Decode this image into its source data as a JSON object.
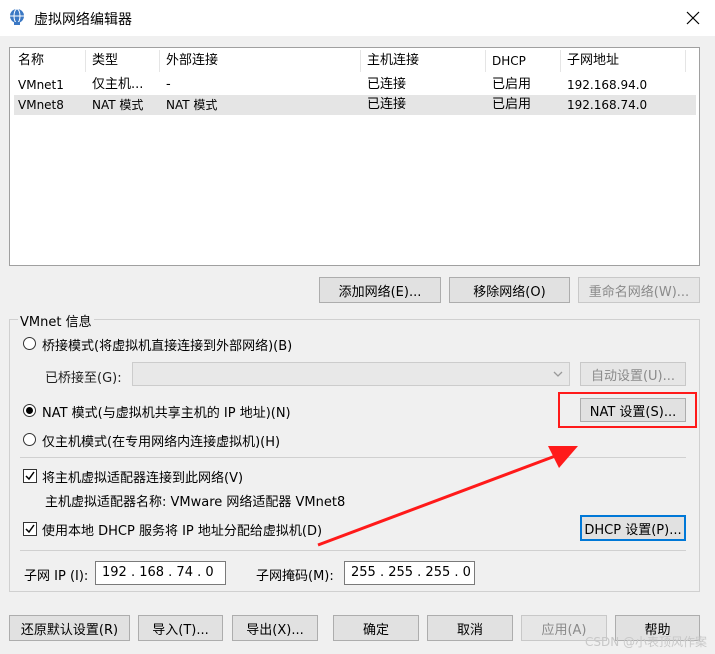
{
  "window": {
    "title": "虚拟网络编辑器",
    "close_label": "关闭"
  },
  "list": {
    "headers": [
      "名称",
      "类型",
      "外部连接",
      "主机连接",
      "DHCP",
      "子网地址"
    ],
    "rows": [
      {
        "name": "VMnet1",
        "type": "仅主机...",
        "external": "-",
        "host": "已连接",
        "dhcp": "已启用",
        "subnet": "192.168.94.0"
      },
      {
        "name": "VMnet8",
        "type": "NAT 模式",
        "external": "NAT 模式",
        "host": "已连接",
        "dhcp": "已启用",
        "subnet": "192.168.74.0"
      }
    ]
  },
  "list_buttons": {
    "add": "添加网络(E)...",
    "remove": "移除网络(O)",
    "rename": "重命名网络(W)..."
  },
  "vmnet_info": {
    "legend": "VMnet 信息",
    "bridged": "桥接模式(将虚拟机直接连接到外部网络)(B)",
    "bridged_to_label": "已桥接至(G):",
    "bridged_to_value": "",
    "auto_settings": "自动设置(U)...",
    "nat": "NAT 模式(与虚拟机共享主机的 IP 地址)(N)",
    "nat_settings": "NAT 设置(S)...",
    "host_only": "仅主机模式(在专用网络内连接虚拟机)(H)",
    "connect_adapter": "将主机虚拟适配器连接到此网络(V)",
    "adapter_name": "主机虚拟适配器名称: VMware 网络适配器 VMnet8",
    "use_dhcp": "使用本地 DHCP 服务将 IP 地址分配给虚拟机(D)",
    "dhcp_settings": "DHCP 设置(P)...",
    "subnet_ip_label": "子网 IP (I):",
    "subnet_ip": "192 . 168 . 74 . 0",
    "subnet_mask_label": "子网掩码(M):",
    "subnet_mask": "255 . 255 . 255 . 0",
    "selected_mode": "nat"
  },
  "footer": {
    "restore": "还原默认设置(R)",
    "import": "导入(T)...",
    "export": "导出(X)...",
    "ok": "确定",
    "cancel": "取消",
    "apply": "应用(A)",
    "help": "帮助"
  },
  "watermark": "CSDN @小表顶风作案",
  "colors": {
    "annotation_red": "#ff1a1a",
    "focus_blue": "#0078d7",
    "selected_row": "#e5e5e5"
  }
}
